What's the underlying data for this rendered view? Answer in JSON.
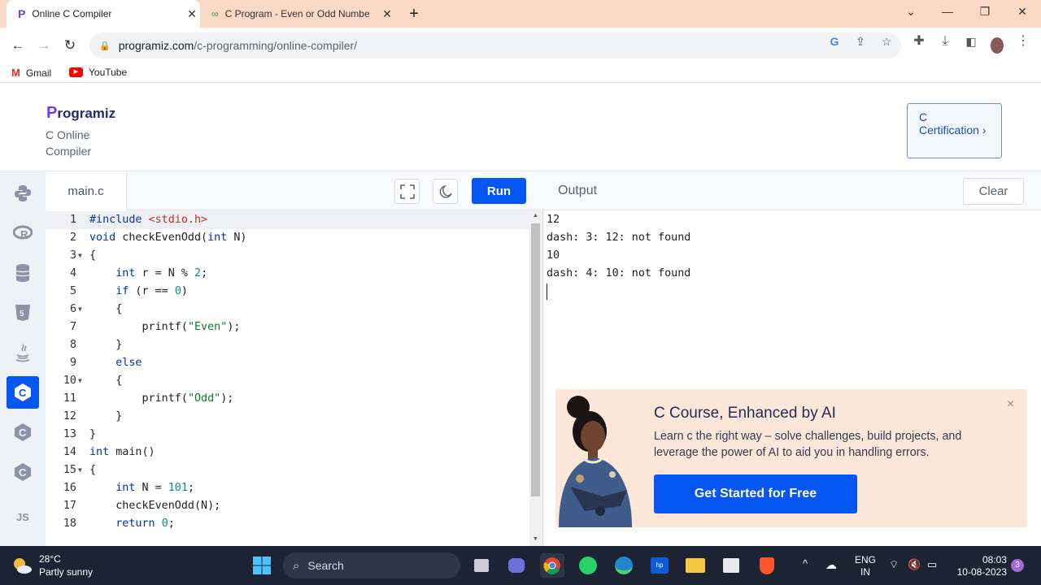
{
  "browser": {
    "tabs": [
      {
        "title": "Online C Compiler"
      },
      {
        "title": "C Program - Even or Odd Numbe"
      }
    ],
    "url_host": "programiz.com",
    "url_path": "/c-programming/online-compiler/",
    "bookmarks": [
      {
        "label": "Gmail"
      },
      {
        "label": "YouTube"
      }
    ]
  },
  "site": {
    "logo_text": "rogramiz",
    "logo_initial": "P",
    "subtitle": "C Online Compiler",
    "cert_button": "C Certification ›"
  },
  "languages": [
    "python-icon",
    "r-icon",
    "sql-icon",
    "html-icon",
    "java-icon",
    "c-icon",
    "cpp-icon",
    "csharp-icon",
    "js-icon"
  ],
  "languages_active": "c-icon",
  "languages_js_label": "JS",
  "editor": {
    "filename": "main.c",
    "run_label": "Run",
    "lines": [
      {
        "n": "1",
        "fold": false
      },
      {
        "n": "2",
        "fold": false
      },
      {
        "n": "3",
        "fold": true
      },
      {
        "n": "4",
        "fold": false
      },
      {
        "n": "5",
        "fold": false
      },
      {
        "n": "6",
        "fold": true
      },
      {
        "n": "7",
        "fold": false
      },
      {
        "n": "8",
        "fold": false
      },
      {
        "n": "9",
        "fold": false
      },
      {
        "n": "10",
        "fold": true
      },
      {
        "n": "11",
        "fold": false
      },
      {
        "n": "12",
        "fold": false
      },
      {
        "n": "13",
        "fold": false
      },
      {
        "n": "14",
        "fold": false
      },
      {
        "n": "15",
        "fold": true
      },
      {
        "n": "16",
        "fold": false
      },
      {
        "n": "17",
        "fold": false
      },
      {
        "n": "18",
        "fold": false
      }
    ],
    "code": {
      "l1_a": "#include",
      "l1_b": "<stdio.h>",
      "l2_a": "void",
      "l2_b": " checkEvenOdd(",
      "l2_c": "int",
      "l2_d": " N)",
      "l3": "{",
      "l4_a": "    ",
      "l4_b": "int",
      "l4_c": " r = N % ",
      "l4_d": "2",
      "l4_e": ";",
      "l5_a": "    ",
      "l5_b": "if",
      "l5_c": " (r == ",
      "l5_d": "0",
      "l5_e": ")",
      "l6": "    {",
      "l7_a": "        printf(",
      "l7_b": "\"Even\"",
      "l7_c": ");",
      "l8": "    }",
      "l9_a": "    ",
      "l9_b": "else",
      "l10": "    {",
      "l11_a": "        printf(",
      "l11_b": "\"Odd\"",
      "l11_c": ");",
      "l12": "    }",
      "l13": "}",
      "l14_a": "int",
      "l14_b": " main()",
      "l15": "{",
      "l16_a": "    ",
      "l16_b": "int",
      "l16_c": " N = ",
      "l16_d": "101",
      "l16_e": ";",
      "l17": "    checkEvenOdd(N);",
      "l18_a": "    ",
      "l18_b": "return",
      "l18_c": " ",
      "l18_d": "0",
      "l18_e": ";"
    }
  },
  "output": {
    "title": "Output",
    "clear_label": "Clear",
    "lines": [
      "12",
      "dash: 3: 12: not found",
      "10",
      "dash: 4: 10: not found"
    ]
  },
  "ad": {
    "title": "C Course, Enhanced by AI",
    "text": "Learn c the right way – solve challenges, build projects, and leverage the power of AI to aid you in handling errors.",
    "button": "Get Started for Free",
    "close": "×"
  },
  "taskbar": {
    "temp": "28°C",
    "weather": "Partly sunny",
    "search": "Search",
    "lang_top": "ENG",
    "lang_bottom": "IN",
    "time": "08:03",
    "date": "10-08-2023",
    "badge": "3"
  },
  "colors": {
    "accent": "#0556f3",
    "tabbar": "#fbd9c7",
    "ad_bg": "#fde7d8"
  }
}
